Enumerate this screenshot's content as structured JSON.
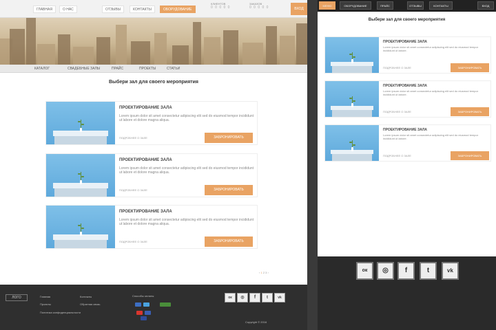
{
  "desktop": {
    "nav": {
      "links": [
        "ГЛАВНАЯ",
        "О НАС",
        "ОТЗЫВЫ",
        "КОНТАКТЫ",
        "ОБОРУДОВАНИЕ"
      ],
      "counters": [
        {
          "label": "КЛИЕНТОВ",
          "value": "0 0 0 0 0"
        },
        {
          "label": "ЗАКАЗОВ",
          "value": "0 0 0 0 0"
        }
      ],
      "login": "ВХОД"
    },
    "subnav": [
      "КАТАЛОГ",
      "СВАДЕБНЫЕ ЗАЛЫ",
      "ПРАЙС",
      "ПРОЕКТЫ",
      "СТАТЬИ"
    ],
    "section_title": "Выбери зал для своего мероприятия",
    "cards": [
      {
        "title": "ПРОЕКТИРОВАНИЕ ЗАЛА",
        "text": "Lorem ipsum dolor sit amet consectetur adipiscing elit sed do eiusmod tempor incididunt ut labore et dolore magna aliqua.",
        "meta": "ПОДРОБНЕЕ О ЗАЛЕ",
        "button": "ЗАБРОНИРОВАТЬ"
      },
      {
        "title": "ПРОЕКТИРОВАНИЕ ЗАЛА",
        "text": "Lorem ipsum dolor sit amet consectetur adipiscing elit sed do eiusmod tempor incididunt ut labore et dolore magna aliqua.",
        "meta": "ПОДРОБНЕЕ О ЗАЛЕ",
        "button": "ЗАБРОНИРОВАТЬ"
      },
      {
        "title": "ПРОЕКТИРОВАНИЕ ЗАЛА",
        "text": "Lorem ipsum dolor sit amet consectetur adipiscing elit sed do eiusmod tempor incididunt ut labore et dolore magna aliqua.",
        "meta": "ПОДРОБНЕЕ О ЗАЛЕ",
        "button": "ЗАБРОНИРОВАТЬ"
      }
    ],
    "pager": {
      "prev": "‹",
      "current": "1",
      "rest": "2 3 ›"
    },
    "footer": {
      "logo": "ЛОГО",
      "col1": [
        "Главная",
        "Проекты",
        "Политика конфиденциальности"
      ],
      "col2": [
        "Контакты",
        "Обратная связь"
      ],
      "pay_title": "Способы оплаты",
      "copyright": "Copyright © 2016"
    }
  },
  "mobile": {
    "tabs": [
      "МЕНЮ",
      "ОБОРУДОВАНИЕ",
      "ПРАЙС",
      "ОТЗЫВЫ",
      "КОНТАКТЫ",
      "ВХОД"
    ],
    "section_title": "Выбери зал для своего мероприятия",
    "cards": [
      {
        "title": "ПРОЕКТИРОВАНИЕ ЗАЛА",
        "text": "Lorem ipsum dolor sit amet consectetur adipiscing elit sed do eiusmod tempor incididunt ut labore.",
        "meta": "ПОДРОБНЕЕ О ЗАЛЕ",
        "button": "ЗАБРОНИРОВАТЬ"
      },
      {
        "title": "ПРОЕКТИРОВАНИЕ ЗАЛА",
        "text": "Lorem ipsum dolor sit amet consectetur adipiscing elit sed do eiusmod tempor incididunt ut labore.",
        "meta": "ПОДРОБНЕЕ О ЗАЛЕ",
        "button": "ЗАБРОНИРОВАТЬ"
      },
      {
        "title": "ПРОЕКТИРОВАНИЕ ЗАЛА",
        "text": "Lorem ipsum dolor sit amet consectetur adipiscing elit sed do eiusmod tempor incididunt ut labore.",
        "meta": "ПОДРОБНЕЕ О ЗАЛЕ",
        "button": "ЗАБРОНИРОВАТЬ"
      }
    ]
  },
  "social": [
    {
      "icon": "odnoklassniki-icon",
      "glyph": "ок"
    },
    {
      "icon": "instagram-icon",
      "glyph": "◎"
    },
    {
      "icon": "facebook-icon",
      "glyph": "f"
    },
    {
      "icon": "twitter-icon",
      "glyph": "t"
    },
    {
      "icon": "vk-icon",
      "glyph": "vk"
    }
  ],
  "colors": {
    "accent": "#e9a363",
    "footer": "#2f2f2f",
    "thumb": "#6fb6e2"
  }
}
